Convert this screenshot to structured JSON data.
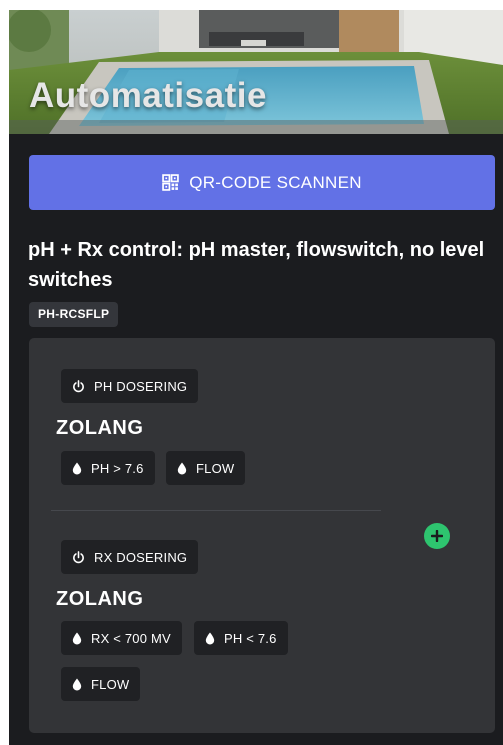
{
  "header": {
    "title": "Automatisatie"
  },
  "qr_button": {
    "label": "QR-CODE SCANNEN",
    "icon": "qr-code-icon",
    "color": "#6271e6"
  },
  "device": {
    "title": "pH + Rx control: pH master, flowswitch, no level switches",
    "model": "PH-RCSFLP"
  },
  "rules": [
    {
      "action_label": "PH DOSERING",
      "action_icon": "power-icon",
      "condition_keyword": "ZOLANG",
      "conditions": [
        {
          "label": "PH > 7.6",
          "icon": "drop-icon"
        },
        {
          "label": "FLOW",
          "icon": "drop-icon"
        }
      ]
    },
    {
      "action_label": "RX DOSERING",
      "action_icon": "power-icon",
      "condition_keyword": "ZOLANG",
      "conditions": [
        {
          "label": "RX < 700 MV",
          "icon": "drop-icon"
        },
        {
          "label": "PH < 7.6",
          "icon": "drop-icon"
        },
        {
          "label": "FLOW",
          "icon": "drop-icon"
        }
      ]
    }
  ],
  "add_button": {
    "icon": "plus-icon",
    "color": "#2ec46f"
  }
}
